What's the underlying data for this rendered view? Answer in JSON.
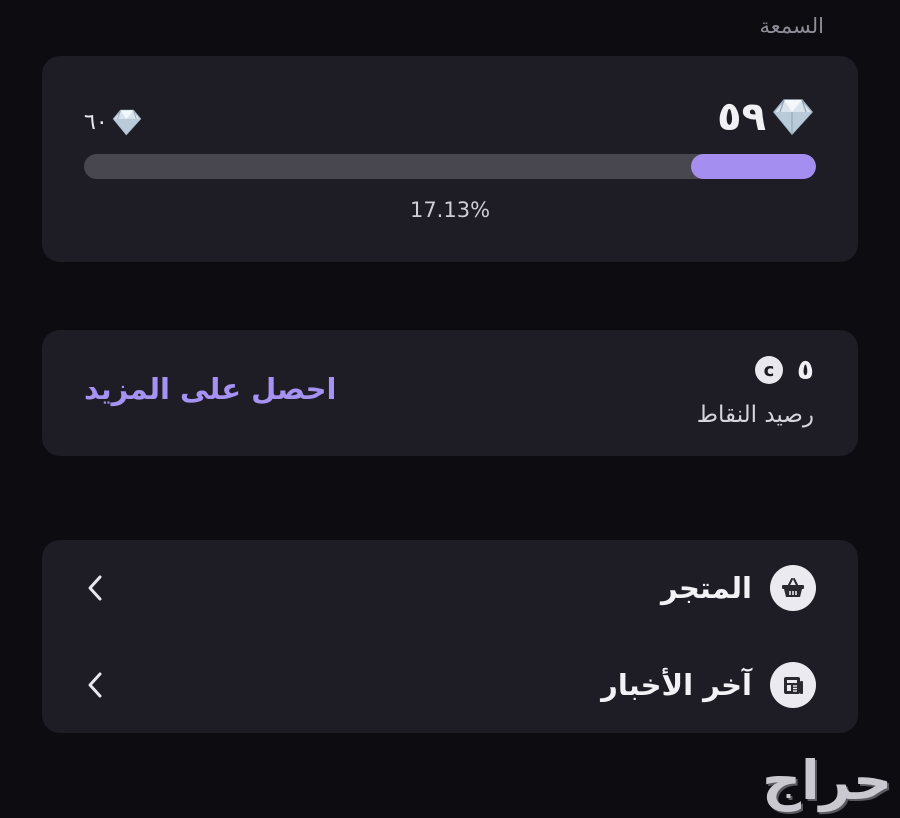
{
  "section_title": "السمعة",
  "reputation": {
    "current_value": "٥٩",
    "target_value": "٦٠",
    "progress_text": "17.13%",
    "progress_fraction": 0.1713,
    "fill_color": "#a48ef0",
    "gem_icon": "diamond-icon"
  },
  "points": {
    "value": "٥",
    "coin_letter": "c",
    "label": "رصيد النقاط",
    "get_more_label": "احصل على المزيد",
    "accent_color": "#a692f2"
  },
  "menu": {
    "items": [
      {
        "label": "المتجر",
        "icon": "shopping-basket-icon"
      },
      {
        "label": "آخر الأخبار",
        "icon": "newspaper-icon"
      }
    ]
  },
  "watermark": "حراج"
}
